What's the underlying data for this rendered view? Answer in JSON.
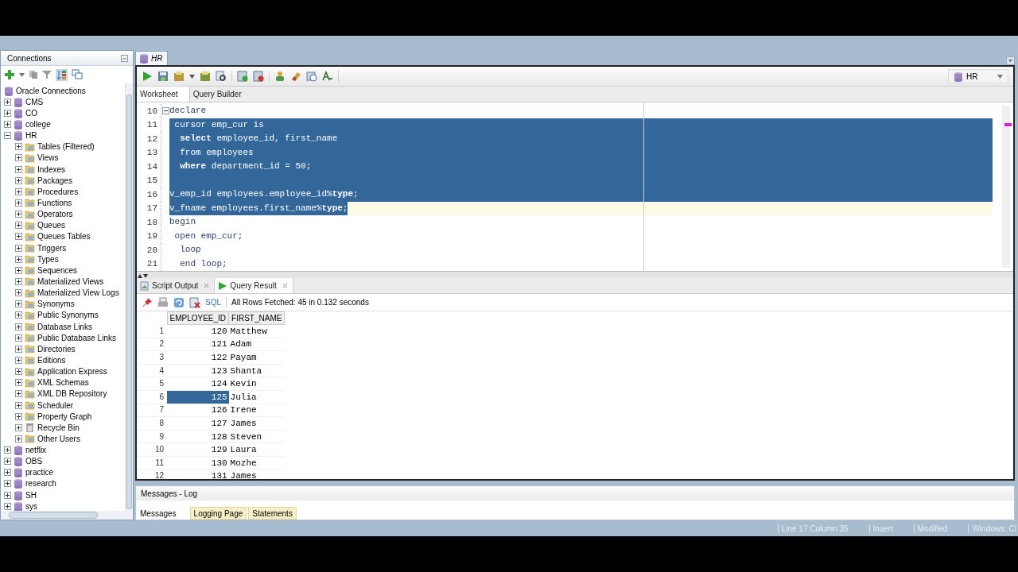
{
  "connections_panel": {
    "title": "Connections",
    "tree": [
      {
        "label": "Oracle Connections",
        "kind": "root",
        "children": [
          {
            "label": "CMS",
            "kind": "connection",
            "expanded": false
          },
          {
            "label": "CO",
            "kind": "connection",
            "expanded": false
          },
          {
            "label": "college",
            "kind": "connection",
            "expanded": false
          },
          {
            "label": "HR",
            "kind": "connection",
            "expanded": true,
            "children": [
              {
                "label": "Tables (Filtered)",
                "kind": "folder",
                "expanded": false
              },
              {
                "label": "Views",
                "kind": "folder",
                "expanded": false
              },
              {
                "label": "Indexes",
                "kind": "folder",
                "expanded": false
              },
              {
                "label": "Packages",
                "kind": "folder",
                "expanded": false
              },
              {
                "label": "Procedures",
                "kind": "folder",
                "expanded": false
              },
              {
                "label": "Functions",
                "kind": "folder",
                "expanded": false
              },
              {
                "label": "Operators",
                "kind": "folder",
                "expanded": false
              },
              {
                "label": "Queues",
                "kind": "folder",
                "expanded": false
              },
              {
                "label": "Queues Tables",
                "kind": "folder",
                "expanded": false
              },
              {
                "label": "Triggers",
                "kind": "folder",
                "expanded": false
              },
              {
                "label": "Types",
                "kind": "folder",
                "expanded": false
              },
              {
                "label": "Sequences",
                "kind": "folder",
                "expanded": false
              },
              {
                "label": "Materialized Views",
                "kind": "folder",
                "expanded": false
              },
              {
                "label": "Materialized View Logs",
                "kind": "folder",
                "expanded": false
              },
              {
                "label": "Synonyms",
                "kind": "folder",
                "expanded": false
              },
              {
                "label": "Public Synonyms",
                "kind": "folder",
                "expanded": false
              },
              {
                "label": "Database Links",
                "kind": "folder",
                "expanded": false
              },
              {
                "label": "Public Database Links",
                "kind": "folder",
                "expanded": false
              },
              {
                "label": "Directories",
                "kind": "folder",
                "expanded": false
              },
              {
                "label": "Editions",
                "kind": "folder",
                "expanded": false
              },
              {
                "label": "Application Express",
                "kind": "folder",
                "expanded": false
              },
              {
                "label": "XML Schemas",
                "kind": "folder",
                "expanded": false
              },
              {
                "label": "XML DB Repository",
                "kind": "folder",
                "expanded": false
              },
              {
                "label": "Scheduler",
                "kind": "folder",
                "expanded": false
              },
              {
                "label": "Property Graph",
                "kind": "folder",
                "expanded": false
              },
              {
                "label": "Recycle Bin",
                "kind": "bin",
                "expanded": false
              },
              {
                "label": "Other Users",
                "kind": "folder",
                "expanded": false
              }
            ]
          },
          {
            "label": "netflix",
            "kind": "connection",
            "expanded": false
          },
          {
            "label": "OBS",
            "kind": "connection",
            "expanded": false
          },
          {
            "label": "practice",
            "kind": "connection",
            "expanded": false
          },
          {
            "label": "research",
            "kind": "connection",
            "expanded": false
          },
          {
            "label": "SH",
            "kind": "connection",
            "expanded": false
          },
          {
            "label": "sys",
            "kind": "connection",
            "expanded": false
          }
        ]
      }
    ]
  },
  "editor": {
    "tab": "HR",
    "connection": "HR",
    "subtabs": [
      {
        "label": "Worksheet",
        "selected": true
      },
      {
        "label": "Query Builder",
        "selected": false
      }
    ],
    "lines": [
      {
        "number": "10",
        "text": "declare",
        "foldable": true,
        "selected": false,
        "current": false
      },
      {
        "number": "11",
        "text": " cursor emp_cur is",
        "foldable": false,
        "selected": true,
        "current": false
      },
      {
        "number": "12",
        "text": "  **select** employee_id, first_name",
        "foldable": false,
        "selected": true,
        "current": false
      },
      {
        "number": "13",
        "text": "  from employees",
        "foldable": false,
        "selected": true,
        "current": false
      },
      {
        "number": "14",
        "text": "  **where** department_id = 50;",
        "foldable": false,
        "selected": true,
        "current": false
      },
      {
        "number": "15",
        "foldable": false,
        "selected": true,
        "current": false
      },
      {
        "number": "16",
        "text": "v_emp_id employees.employee_id%**type**;",
        "foldable": false,
        "selected": true,
        "current": false
      },
      {
        "number": "17",
        "text": "v_fname employees.first_name%**type**;",
        "foldable": false,
        "selected": true,
        "current": true
      },
      {
        "number": "18",
        "text": "begin",
        "foldable": false,
        "selected": false,
        "current": false
      },
      {
        "number": "19",
        "text": " open emp_cur;",
        "foldable": false,
        "selected": false,
        "current": false
      },
      {
        "number": "20",
        "text": "  loop",
        "foldable": false,
        "selected": false,
        "current": false
      },
      {
        "number": "21",
        "text": "  end loop;",
        "foldable": false,
        "selected": false,
        "current": false
      }
    ]
  },
  "results": {
    "tabs": [
      {
        "label": "Script Output",
        "selected": false
      },
      {
        "label": "Query Result",
        "selected": true
      }
    ],
    "sql_label": "SQL",
    "status": "All Rows Fetched: 45 in 0.132 seconds",
    "columns": [
      "EMPLOYEE_ID",
      "FIRST_NAME"
    ],
    "rows": [
      {
        "number": "1",
        "cells": [
          "120",
          "Matthew"
        ],
        "selected": false
      },
      {
        "number": "2",
        "cells": [
          "121",
          "Adam"
        ],
        "selected": false
      },
      {
        "number": "3",
        "cells": [
          "122",
          "Payam"
        ],
        "selected": false
      },
      {
        "number": "4",
        "cells": [
          "123",
          "Shanta"
        ],
        "selected": false
      },
      {
        "number": "5",
        "cells": [
          "124",
          "Kevin"
        ],
        "selected": false
      },
      {
        "number": "6",
        "cells": [
          "125",
          "Julia"
        ],
        "selected": true
      },
      {
        "number": "7",
        "cells": [
          "126",
          "Irene"
        ],
        "selected": false
      },
      {
        "number": "8",
        "cells": [
          "127",
          "James"
        ],
        "selected": false
      },
      {
        "number": "9",
        "cells": [
          "128",
          "Steven"
        ],
        "selected": false
      },
      {
        "number": "10",
        "cells": [
          "129",
          "Laura"
        ],
        "selected": false
      },
      {
        "number": "11",
        "cells": [
          "130",
          "Mozhe"
        ],
        "selected": false
      },
      {
        "number": "12",
        "cells": [
          "131",
          "James"
        ],
        "selected": false
      }
    ]
  },
  "messages_log": {
    "title": "Messages - Log",
    "tabs": [
      {
        "label": "Messages",
        "selected": true
      },
      {
        "label": "Logging Page",
        "selected": false
      },
      {
        "label": "Statements",
        "selected": false
      }
    ]
  },
  "status_bar": [
    "Line 17 Column 35",
    "Insert",
    "Modified",
    "Windows: Cl"
  ]
}
